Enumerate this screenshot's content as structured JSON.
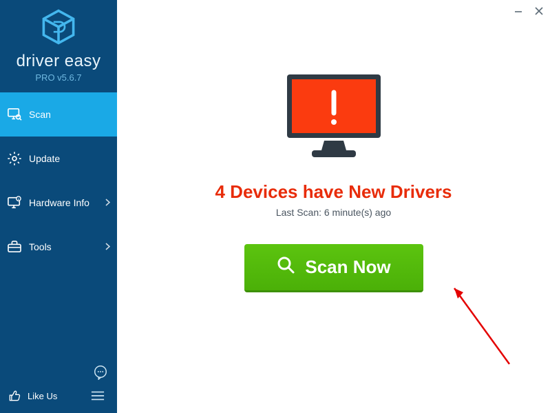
{
  "brand": {
    "name": "driver easy",
    "version": "PRO v5.6.7"
  },
  "sidebar": {
    "items": [
      {
        "label": "Scan",
        "icon": "monitor-search-icon",
        "active": true
      },
      {
        "label": "Update",
        "icon": "gear-icon",
        "active": false
      },
      {
        "label": "Hardware Info",
        "icon": "monitor-info-icon",
        "active": false,
        "hasSub": true
      },
      {
        "label": "Tools",
        "icon": "toolbox-icon",
        "active": false,
        "hasSub": true
      }
    ],
    "likeUs": "Like Us"
  },
  "main": {
    "statusHeading": "4 Devices have New Drivers",
    "lastScan": "Last Scan: 6 minute(s) ago",
    "scanButton": "Scan Now"
  }
}
